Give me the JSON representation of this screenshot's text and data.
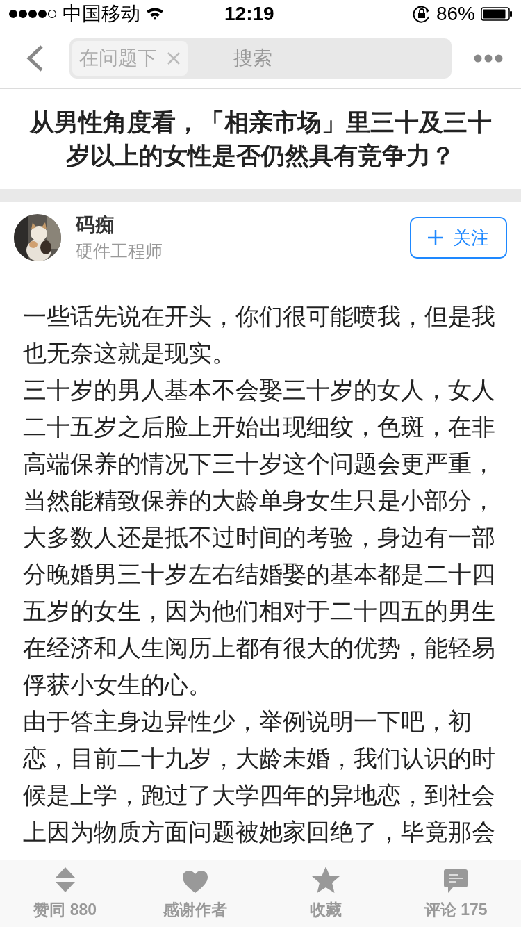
{
  "status_bar": {
    "carrier": "中国移动",
    "time": "12:19",
    "battery": "86%"
  },
  "nav": {
    "scope_chip": "在问题下",
    "search_placeholder": "搜索"
  },
  "question": {
    "title": "从男性角度看，「相亲市场」里三十及三十岁以上的女性是否仍然具有竞争力？"
  },
  "author": {
    "name": "码痴",
    "bio": "硬件工程师",
    "follow_button": "关注"
  },
  "answer": {
    "paragraphs": [
      "一些话先说在开头，你们很可能喷我，但是我也无奈这就是现实。",
      "三十岁的男人基本不会娶三十岁的女人，女人二十五岁之后脸上开始出现细纹，色斑，在非高端保养的情况下三十岁这个问题会更严重，当然能精致保养的大龄单身女生只是小部分，大多数人还是抵不过时间的考验，身边有一部分晚婚男三十岁左右结婚娶的基本都是二十四五岁的女生，因为他们相对于二十四五的男生在经济和人生阅历上都有很大的优势，能轻易俘获小女生的心。",
      "由于答主身边异性少，举例说明一下吧，初恋，目前二十九岁，大龄未婚，我们认识的时候是上学，跑过了大学四年的异地恋，到社会上因为物质方面问题被她家回绝了，毕竟那会"
    ]
  },
  "toolbar": [
    {
      "kind": "vote",
      "label": "赞同 880"
    },
    {
      "kind": "thanks",
      "label": "感谢作者"
    },
    {
      "kind": "collect",
      "label": "收藏"
    },
    {
      "kind": "comment",
      "label": "评论 175"
    }
  ]
}
